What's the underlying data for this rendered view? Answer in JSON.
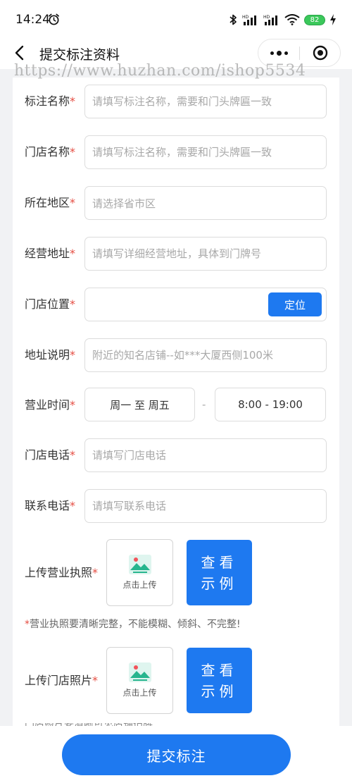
{
  "status_bar": {
    "time": "14:24",
    "network_label_1": "HD",
    "network_label_2": "HD",
    "battery": "82"
  },
  "nav": {
    "title": "提交标注资料"
  },
  "watermark": "https://www.huzhan.com/ishop5534",
  "form": {
    "required_mark": "*",
    "marker_name": {
      "label": "标注名称",
      "placeholder": "请填写标注名称，需要和门头牌匾一致"
    },
    "store_name": {
      "label": "门店名称",
      "placeholder": "请填写标注名称，需要和门头牌匾一致"
    },
    "region": {
      "label": "所在地区",
      "placeholder": "请选择省市区"
    },
    "address": {
      "label": "经营地址",
      "placeholder": "请填写详细经营地址，具体到门牌号"
    },
    "location": {
      "label": "门店位置",
      "button": "定位"
    },
    "address_note": {
      "label": "地址说明",
      "placeholder": "附近的知名店铺--如***大厦西侧100米"
    },
    "hours": {
      "label": "营业时间",
      "days": "周一 至 周五",
      "separator": "-",
      "time": "8:00 - 19:00"
    },
    "store_phone": {
      "label": "门店电话",
      "placeholder": "请填写门店电话"
    },
    "contact_phone": {
      "label": "联系电话",
      "placeholder": "请填写联系电话"
    },
    "license": {
      "label": "上传营业执照",
      "upload_label": "点击上传",
      "example_button": "查看示例",
      "note": "营业执照要清晰完整，不能模糊、倾斜、不完整!"
    },
    "store_photo": {
      "label": "上传门店照片",
      "upload_label": "点击上传",
      "example_button": "查看示例",
      "note": "门店照片要清晰可见店铺招牌"
    }
  },
  "submit_button": "提交标注",
  "colors": {
    "accent": "#1e79f0",
    "required": "#e54d42",
    "background": "#f1f2f4"
  }
}
